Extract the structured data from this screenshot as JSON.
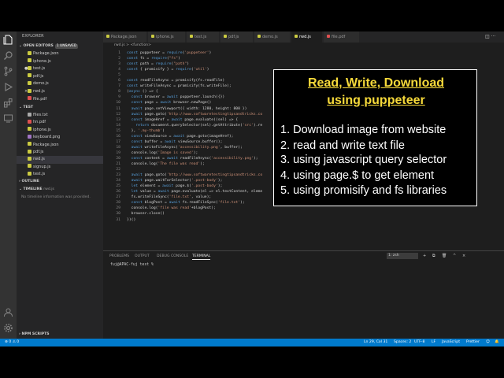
{
  "colors": {
    "accent": "#007acc",
    "overlay_title": "#f6d93a",
    "keyword": "#569cd6",
    "string": "#ce9178"
  },
  "activity_bar": {
    "icons": [
      "files-icon",
      "search-icon",
      "source-control-icon",
      "debug-icon",
      "extensions-icon",
      "remote-icon",
      "account-icon",
      "gear-icon"
    ]
  },
  "sidebar": {
    "title": "EXPLORER",
    "open_editors": {
      "label": "OPEN EDITORS",
      "badge": "1 UNSAVED",
      "items": [
        {
          "name": "Package.json",
          "icon_color": "#cbcb41"
        },
        {
          "name": "iphone.js",
          "icon_color": "#cbcb41"
        },
        {
          "name": "test.js",
          "icon_color": "#cbcb41",
          "dot": "●"
        },
        {
          "name": "pdf.js",
          "icon_color": "#cbcb41"
        },
        {
          "name": "demo.js",
          "icon_color": "#cbcb41"
        },
        {
          "name": "rwd.js",
          "icon_color": "#cbcb41",
          "close": "×"
        },
        {
          "name": "file.pdf",
          "icon_color": "#e05050"
        }
      ]
    },
    "test_folder": {
      "label": "TEST",
      "items": [
        {
          "name": "files.txt",
          "icon_color": "#aaaaaa"
        },
        {
          "name": "hn.pdf",
          "icon_color": "#e05050"
        },
        {
          "name": "iphone.js",
          "icon_color": "#cbcb41"
        },
        {
          "name": "keyboard.png",
          "icon_color": "#a074c4"
        },
        {
          "name": "Package.json",
          "icon_color": "#cbcb41"
        },
        {
          "name": "pdf.js",
          "icon_color": "#cbcb41"
        },
        {
          "name": "rwd.js",
          "icon_color": "#cbcb41"
        },
        {
          "name": "signup.js",
          "icon_color": "#cbcb41"
        },
        {
          "name": "test.js",
          "icon_color": "#cbcb41"
        }
      ]
    },
    "outline_label": "OUTLINE",
    "timeline_label": "TIMELINE",
    "timeline_file": "rwd.js",
    "timeline_msg": "No timeline information was provided.",
    "npm_scripts": "NPM SCRIPTS"
  },
  "tabs": [
    {
      "label": "Package.json",
      "color": "#cbcb41"
    },
    {
      "label": "iphone.js",
      "color": "#cbcb41"
    },
    {
      "label": "test.js",
      "color": "#cbcb41"
    },
    {
      "label": "pdf.js",
      "color": "#cbcb41"
    },
    {
      "label": "demo.js",
      "color": "#cbcb41"
    },
    {
      "label": "rwd.js",
      "color": "#cbcb41",
      "active": true
    },
    {
      "label": "file.pdf",
      "color": "#e05050"
    }
  ],
  "tab_actions": "◫ ···",
  "breadcrumb": "rwd.js > <function>",
  "code_lines": [
    "const puppeteer = require('puppeteer')",
    "const fs = require(\"fs\")",
    "const path = require(\"path\")",
    "const { promisify } = require('util')",
    "",
    "const readFileAsync = promisify(fs.readFile)",
    "const writeFileAsync = promisify(fs.writeFile);",
    "(async () => {",
    "  const browser = await puppeteer.launch({})",
    "  const page = await browser.newPage()",
    "  await page.setViewport({ width: 1280, height: 800 })",
    "  await page.goto('http://www.softwaretestingtipsandtricks.co",
    "  const imageHref = await page.evaluate((sel) => {",
    "    return document.querySelector(sel).getAttribute('src').re",
    "  }, '.my-thumb')",
    "  const viewSource = await page.goto(imageHref);",
    "  const buffer = await viewSource.buffer();",
    "  await writeFileAsync('accessibility.png', buffer);",
    "  console.log('Image is saved');",
    "  const content = await readFileAsync('accessibility.png');",
    "  console.log('The file was read');",
    "",
    "  await page.goto('http://www.softwaretestingtipsandtricks.co",
    "  await page.waitForSelector('.post-body');",
    "  let element = await page.$('.post-body');",
    "  let value = await page.evaluate(el => el.textContent, eleme",
    "  fs.writeFileSync('file.txt', value);",
    "  const blogPost = await fs.readFileSync('file.txt');",
    "  console.log('file was read'+blogPost);",
    "  browser.close()",
    "})()"
  ],
  "panel": {
    "tabs": [
      "PROBLEMS",
      "OUTPUT",
      "DEBUG CONSOLE",
      "TERMINAL"
    ],
    "terminal_select": "1: zsh",
    "icons": [
      "+",
      "⧉",
      "🗑",
      "^",
      "×"
    ],
    "terminal_line": "fuj@APAC-fuj test %"
  },
  "status_bar": {
    "left": [
      "⊗ 0 ⚠ 0"
    ],
    "right": [
      "Ln 29, Col 31",
      "Spaces: 2",
      "UTF-8",
      "LF",
      "JavaScript",
      "Prettier",
      "☺",
      "🔔"
    ]
  },
  "overlay": {
    "title_line1": "Read, Write, Download",
    "title_line2": "using puppeteer",
    "items": [
      "1. Download image from website",
      "2. read and write text file",
      "3. using javascript query selector",
      "4. using page.$ to get element",
      "5. using promisify and fs libraries"
    ]
  }
}
